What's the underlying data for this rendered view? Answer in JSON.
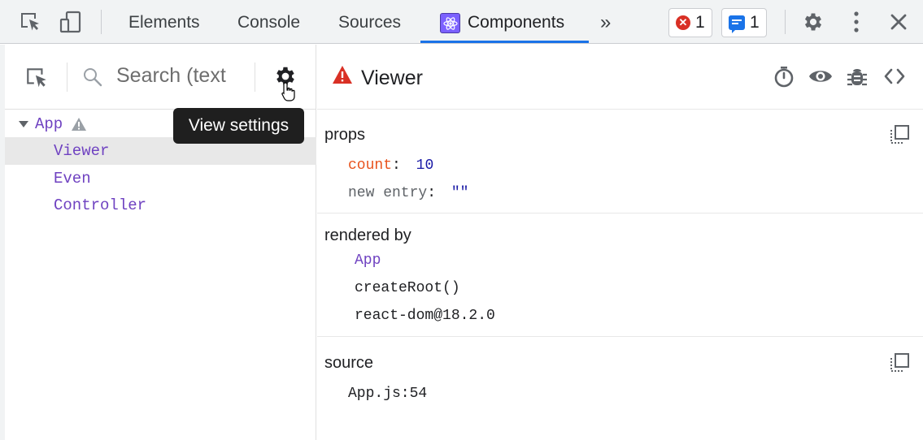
{
  "toolbar": {
    "tabs": [
      "Elements",
      "Console",
      "Sources",
      "Components"
    ],
    "active_tab": "Components",
    "more_tabs_glyph": "»",
    "errors_count": "1",
    "messages_count": "1",
    "icons": [
      "inspect-element-icon",
      "device-toggle-icon",
      "settings-gear-icon",
      "kebab-menu-icon",
      "close-icon"
    ],
    "accent_color": "#1a73e8",
    "error_color": "#d93025"
  },
  "left_panel": {
    "search_placeholder": "Search (text",
    "tooltip": "View settings",
    "tree": [
      {
        "label": "App",
        "depth": 0,
        "expanded": true,
        "warning": true
      },
      {
        "label": "Viewer",
        "depth": 1,
        "selected": true
      },
      {
        "label": "Even",
        "depth": 1
      },
      {
        "label": "Controller",
        "depth": 1
      }
    ]
  },
  "right_panel": {
    "title": "Viewer",
    "props_label": "props",
    "props": [
      {
        "key": "count",
        "value": "10"
      },
      {
        "key": "new entry",
        "value": "\"\""
      }
    ],
    "rendered_by_label": "rendered by",
    "rendered_by": [
      "App",
      "createRoot()",
      "react-dom@18.2.0"
    ],
    "source_label": "source",
    "source": "App.js:54"
  }
}
